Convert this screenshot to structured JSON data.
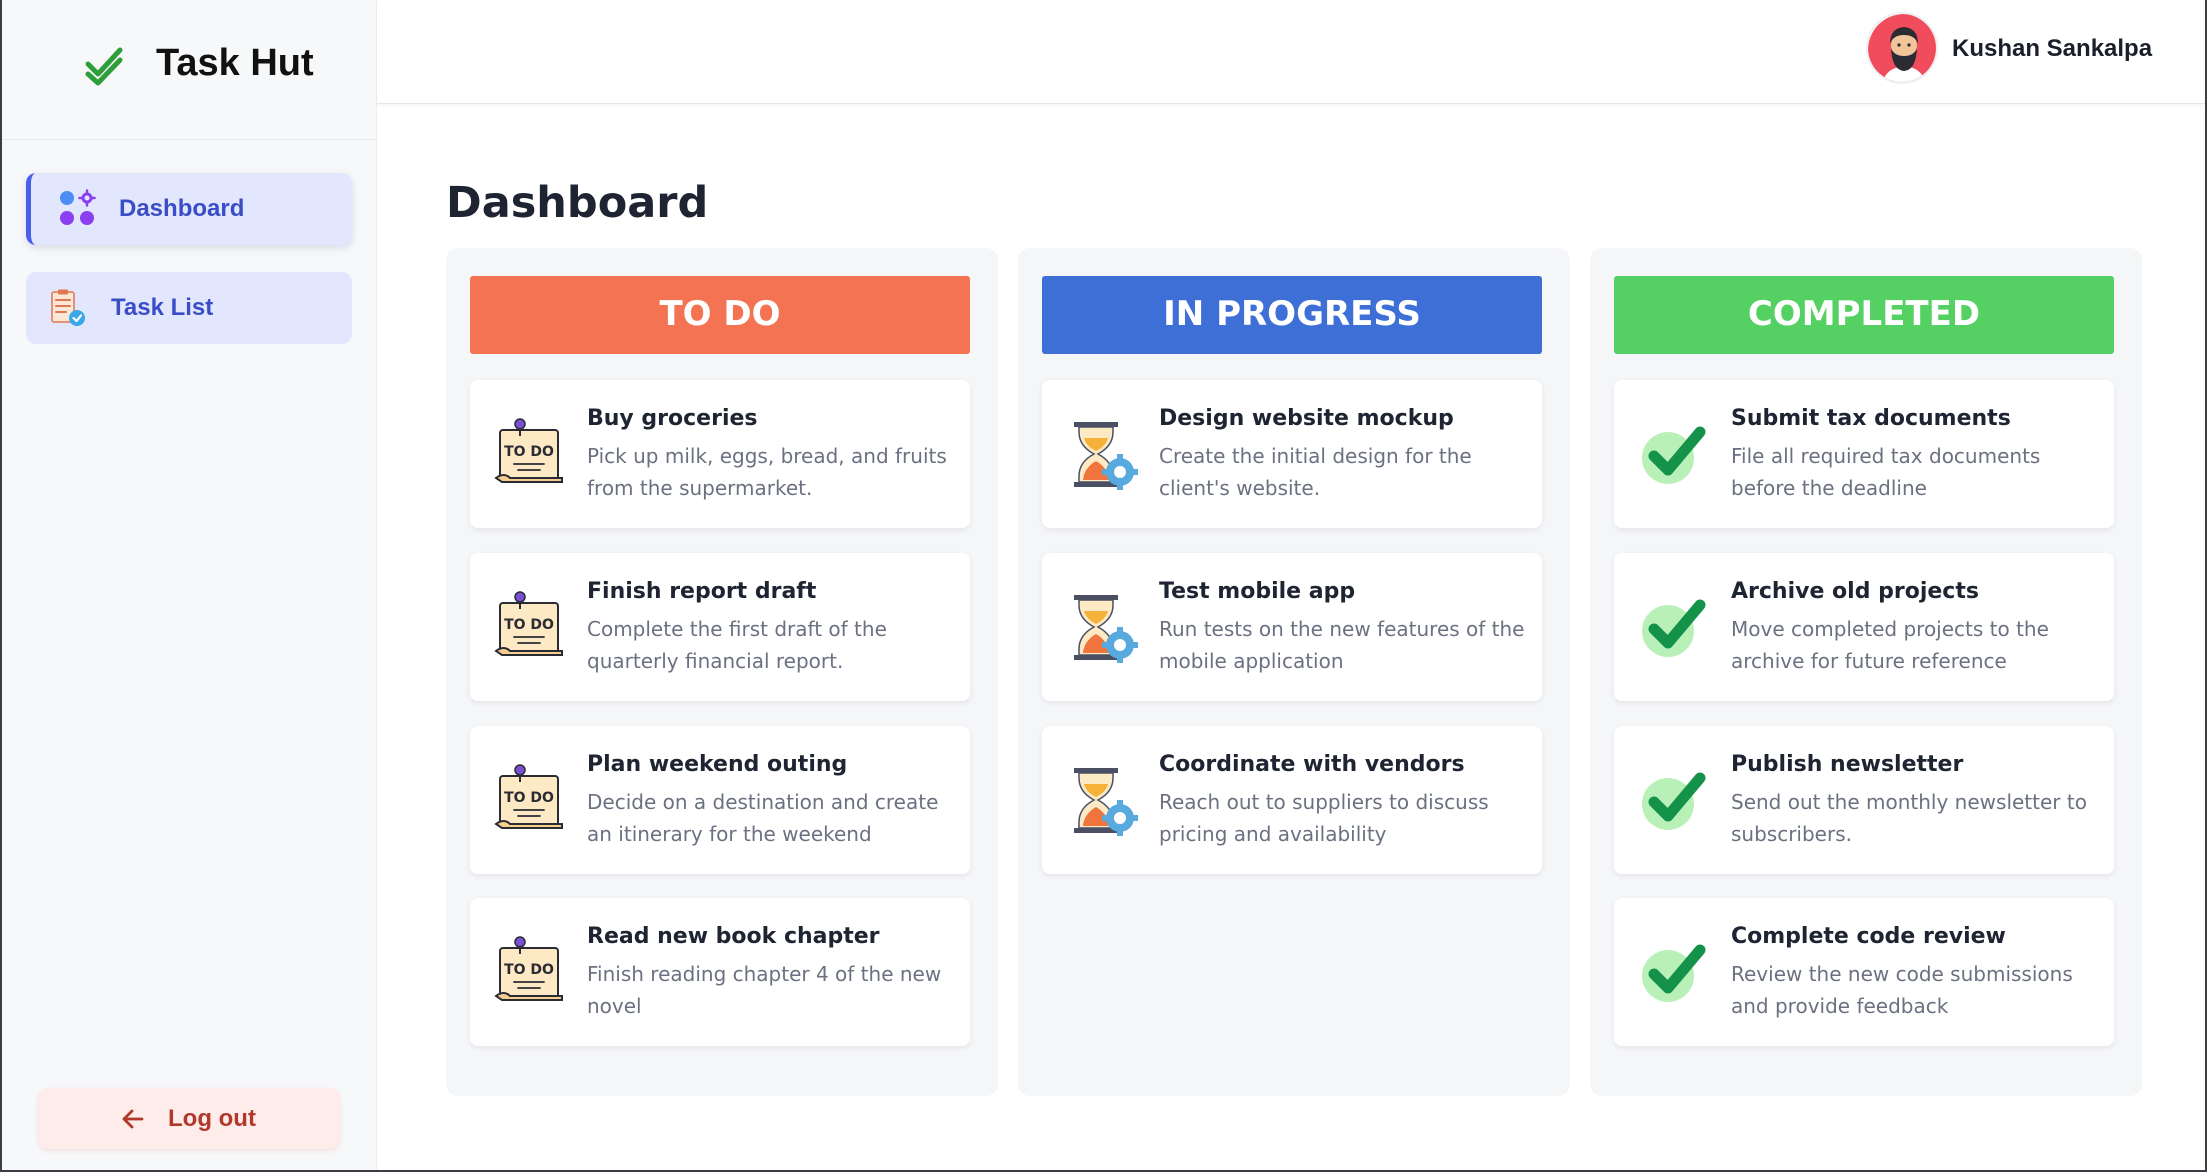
{
  "app": {
    "title": "Task Hut"
  },
  "sidebar": {
    "items": [
      {
        "label": "Dashboard",
        "icon": "dashboard-icon",
        "active": true
      },
      {
        "label": "Task List",
        "icon": "task-list-icon",
        "active": false
      }
    ],
    "logout_label": "Log out"
  },
  "header": {
    "user_name": "Kushan Sankalpa"
  },
  "main": {
    "title": "Dashboard",
    "columns": [
      {
        "title": "TO DO",
        "color": "#f37352",
        "icon": "todo-note-icon",
        "cards": [
          {
            "title": "Buy groceries",
            "description": "Pick up milk, eggs, bread, and fruits from the supermarket."
          },
          {
            "title": "Finish report draft",
            "description": "Complete the first draft of the quarterly financial report."
          },
          {
            "title": "Plan weekend outing",
            "description": "Decide on a destination and create an itinerary for the weekend"
          },
          {
            "title": "Read new book chapter",
            "description": "Finish reading chapter 4 of the new novel"
          }
        ]
      },
      {
        "title": "IN PROGRESS",
        "color": "#3d6fd6",
        "icon": "hourglass-gear-icon",
        "cards": [
          {
            "title": "Design website mockup",
            "description": "Create the initial design for the client's website."
          },
          {
            "title": "Test mobile app",
            "description": "Run tests on the new features of the mobile application"
          },
          {
            "title": "Coordinate with vendors",
            "description": "Reach out to suppliers to discuss pricing and availability"
          }
        ]
      },
      {
        "title": "COMPLETED",
        "color": "#55d063",
        "icon": "green-checkmark-icon",
        "cards": [
          {
            "title": "Submit tax documents",
            "description": "File all required tax documents before the deadline"
          },
          {
            "title": "Archive old projects",
            "description": "Move completed projects to the archive for future reference"
          },
          {
            "title": "Publish newsletter",
            "description": "Send out the monthly newsletter to subscribers."
          },
          {
            "title": "Complete code review",
            "description": "Review the new code submissions and provide feedback"
          }
        ]
      }
    ]
  }
}
